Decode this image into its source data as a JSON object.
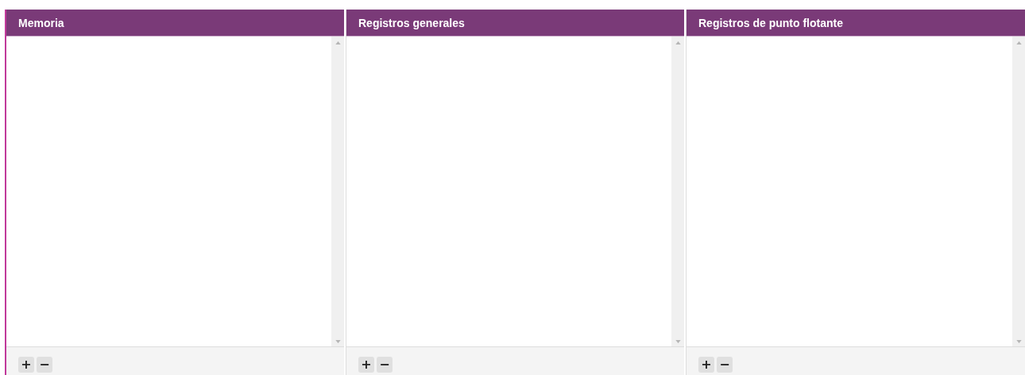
{
  "panels": [
    {
      "title": "Memoria",
      "buttons": [
        "+",
        "−"
      ]
    },
    {
      "title": "Registros generales",
      "buttons": [
        "+",
        "−"
      ]
    },
    {
      "title": "Registros de punto flotante",
      "buttons": [
        "+",
        "−"
      ]
    }
  ]
}
